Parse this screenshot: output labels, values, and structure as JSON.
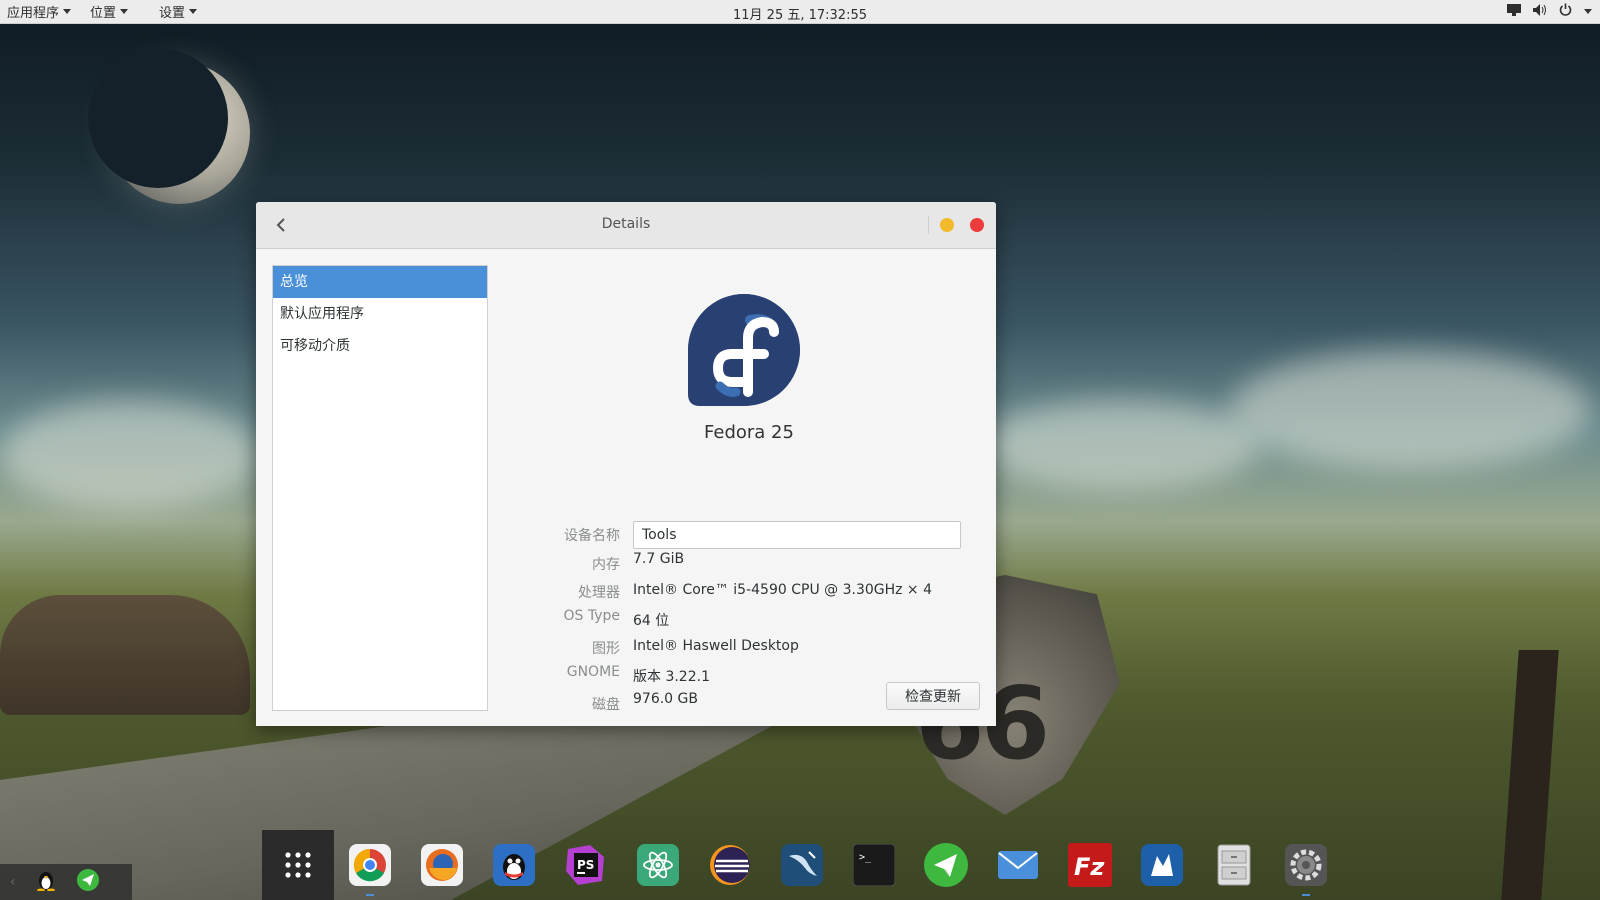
{
  "top_panel": {
    "menus": [
      {
        "label": "应用程序"
      },
      {
        "label": "位置"
      },
      {
        "label": "设置"
      }
    ],
    "clock": "11月 25 五, 17:32:55",
    "tray_icons": [
      "display-icon",
      "volume-icon",
      "power-icon"
    ]
  },
  "window": {
    "title": "Details",
    "sidebar": [
      {
        "label": "总览",
        "active": true
      },
      {
        "label": "默认应用程序",
        "active": false
      },
      {
        "label": "可移动介质",
        "active": false
      }
    ],
    "os_name": "Fedora 25",
    "fields": {
      "device_name_label": "设备名称",
      "device_name_value": "Tools",
      "memory_label": "内存",
      "memory_value": "7.7 GiB",
      "processor_label": "处理器",
      "processor_value": "Intel® Core™ i5-4590 CPU @ 3.30GHz × 4",
      "os_type_label": "OS Type",
      "os_type_value": "64 位",
      "graphics_label": "图形",
      "graphics_value": "Intel® Haswell Desktop",
      "gnome_label": "GNOME",
      "gnome_value": "版本 3.22.1",
      "disk_label": "磁盘",
      "disk_value": "976.0 GB"
    },
    "update_button": "检查更新"
  },
  "dock": {
    "left_items": [
      "tux-icon",
      "telegram-icon"
    ],
    "items": [
      {
        "name": "app-grid-button",
        "icon": "grid-icon",
        "color": "#2b2b2b"
      },
      {
        "name": "chrome-launcher",
        "icon": "chrome-icon",
        "color": "#e8e8e8",
        "running": true
      },
      {
        "name": "firefox-launcher",
        "icon": "firefox-icon",
        "color": "#e86d1f"
      },
      {
        "name": "qq-launcher",
        "icon": "qq-icon",
        "color": "#2d6fc4"
      },
      {
        "name": "phpstorm-launcher",
        "icon": "phpstorm-icon",
        "color": "#b43fd0",
        "glyph": "PS"
      },
      {
        "name": "atom-launcher",
        "icon": "atom-icon",
        "color": "#3aa878"
      },
      {
        "name": "eclipse-launcher",
        "icon": "eclipse-icon",
        "color": "#2c2255"
      },
      {
        "name": "mysql-workbench-launcher",
        "icon": "mysql-icon",
        "color": "#1f4f78"
      },
      {
        "name": "terminal-launcher",
        "icon": "terminal-icon",
        "color": "#1a1a1a",
        "glyph": ">_"
      },
      {
        "name": "telegram-launcher",
        "icon": "telegram-icon",
        "color": "#3fb83f"
      },
      {
        "name": "mail-launcher",
        "icon": "mail-icon",
        "color": "#4a8fd9"
      },
      {
        "name": "filezilla-launcher",
        "icon": "filezilla-icon",
        "color": "#c41a1a",
        "glyph": "Fz"
      },
      {
        "name": "sequel-launcher",
        "icon": "database-icon",
        "color": "#1d5fa8"
      },
      {
        "name": "files-launcher",
        "icon": "file-cabinet-icon",
        "color": "#d8d8d8"
      },
      {
        "name": "settings-launcher",
        "icon": "gear-icon",
        "color": "#555555",
        "running": true
      }
    ]
  }
}
